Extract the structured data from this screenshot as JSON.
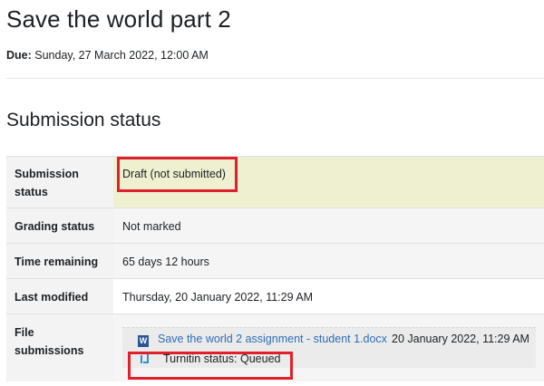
{
  "page": {
    "title": "Save the world part 2",
    "due_label": "Due:",
    "due_value": "Sunday, 27 March 2022, 12:00 AM"
  },
  "submission": {
    "section_title": "Submission status",
    "rows": [
      {
        "label_line1": "Submission",
        "label_line2": "status",
        "value": "Draft (not submitted)"
      },
      {
        "label": "Grading status",
        "value": "Not marked"
      },
      {
        "label": "Time remaining",
        "value": "65 days 12 hours"
      },
      {
        "label": "Last modified",
        "value": "Thursday, 20 January 2022, 11:29 AM"
      },
      {
        "label_line1": "File",
        "label_line2": "submissions"
      }
    ],
    "file": {
      "name": "Save the world 2 assignment - student 1.docx",
      "date": "20 January 2022, 11:29 AM",
      "icon": "word-document-icon"
    },
    "turnitin": {
      "status": "Turnitin status: Queued",
      "icon": "turnitin-icon"
    }
  },
  "colors": {
    "highlight": "#e0202a",
    "draft_bg": "#eef0cf",
    "link": "#2f6db5"
  }
}
